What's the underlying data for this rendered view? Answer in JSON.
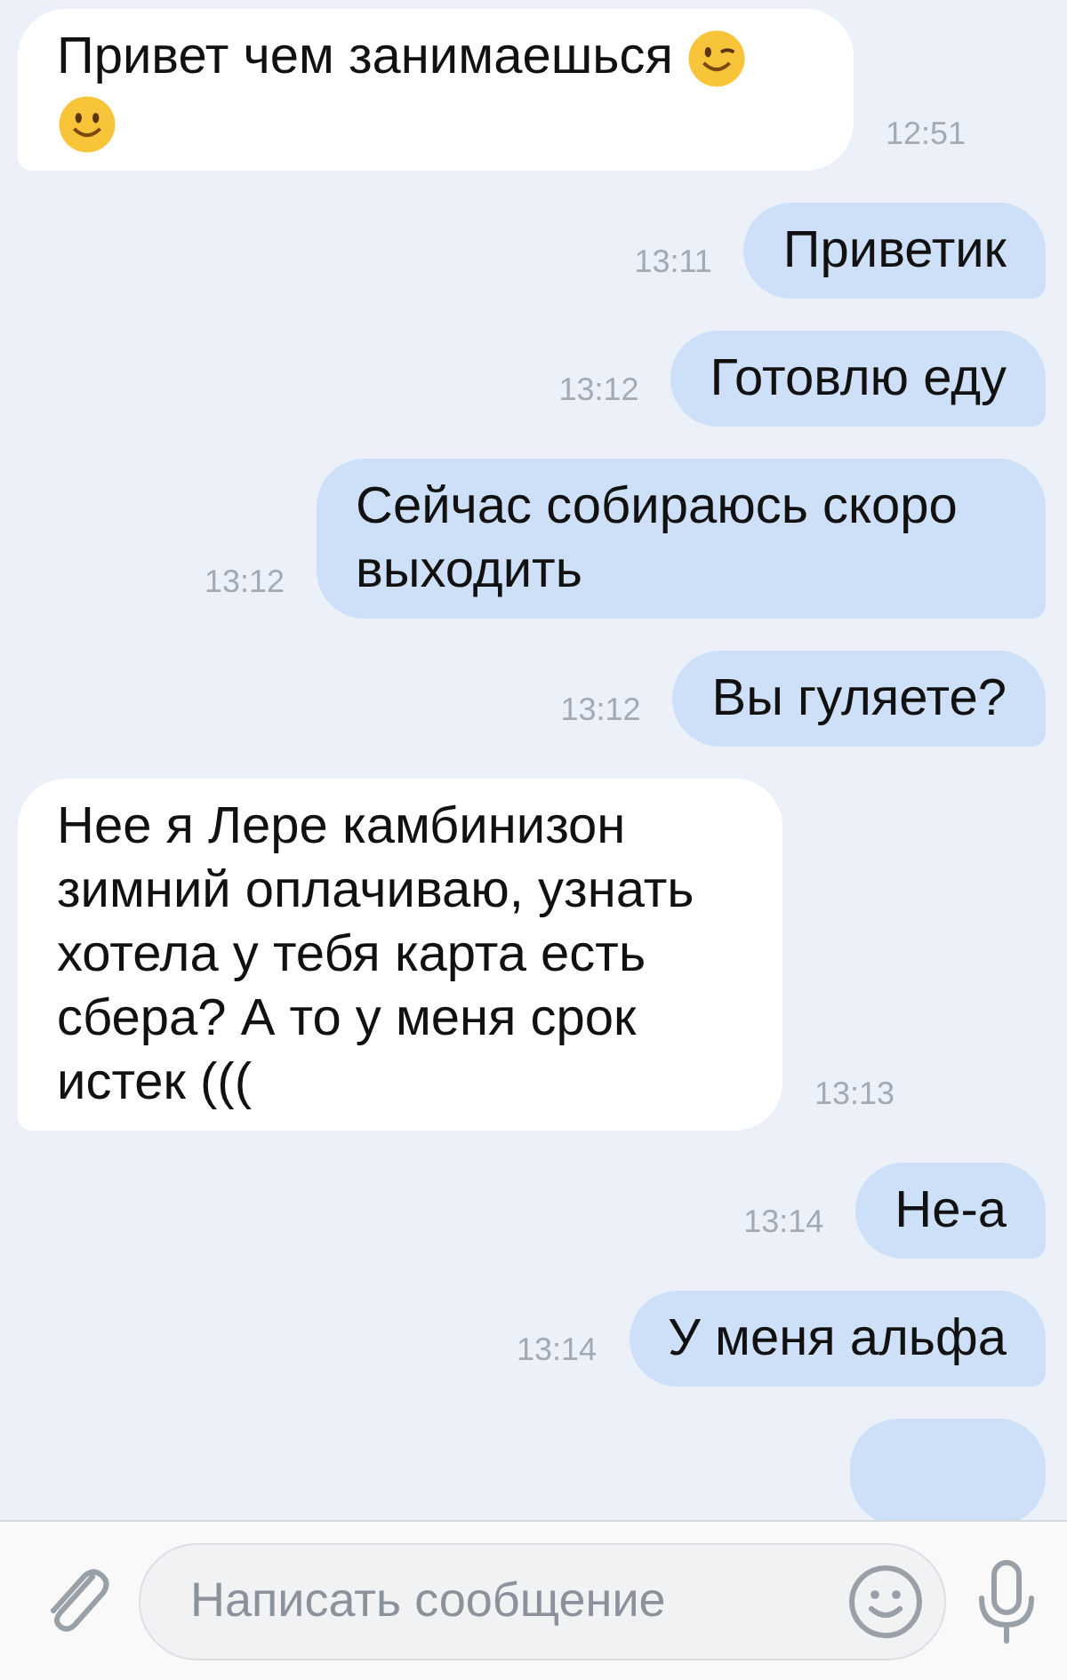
{
  "messages": [
    {
      "kind": "incoming",
      "text": "Привет чем занимаешься",
      "emoji": [
        {
          "kind": "wink"
        },
        {
          "kind": "smile"
        }
      ],
      "time": "12:51"
    },
    {
      "kind": "outgoing",
      "text": "Приветик",
      "time": "13:11"
    },
    {
      "kind": "outgoing",
      "text": "Готовлю еду",
      "time": "13:12"
    },
    {
      "kind": "outgoing",
      "text": "Сейчас собираюсь скоро выходить",
      "time": "13:12"
    },
    {
      "kind": "outgoing",
      "text": "Вы гуляете?",
      "time": "13:12"
    },
    {
      "kind": "incoming",
      "text": "Нее я Лере камбинизон зимний оплачиваю, узнать хотела у тебя карта есть сбера? А то у меня срок истек (((",
      "time": "13:13"
    },
    {
      "kind": "outgoing",
      "text": "Не-а",
      "time": "13:14"
    },
    {
      "kind": "outgoing",
      "text": "У меня альфа",
      "time": "13:14"
    },
    {
      "kind": "partial"
    }
  ],
  "composer": {
    "placeholder": "Написать сообщение"
  }
}
